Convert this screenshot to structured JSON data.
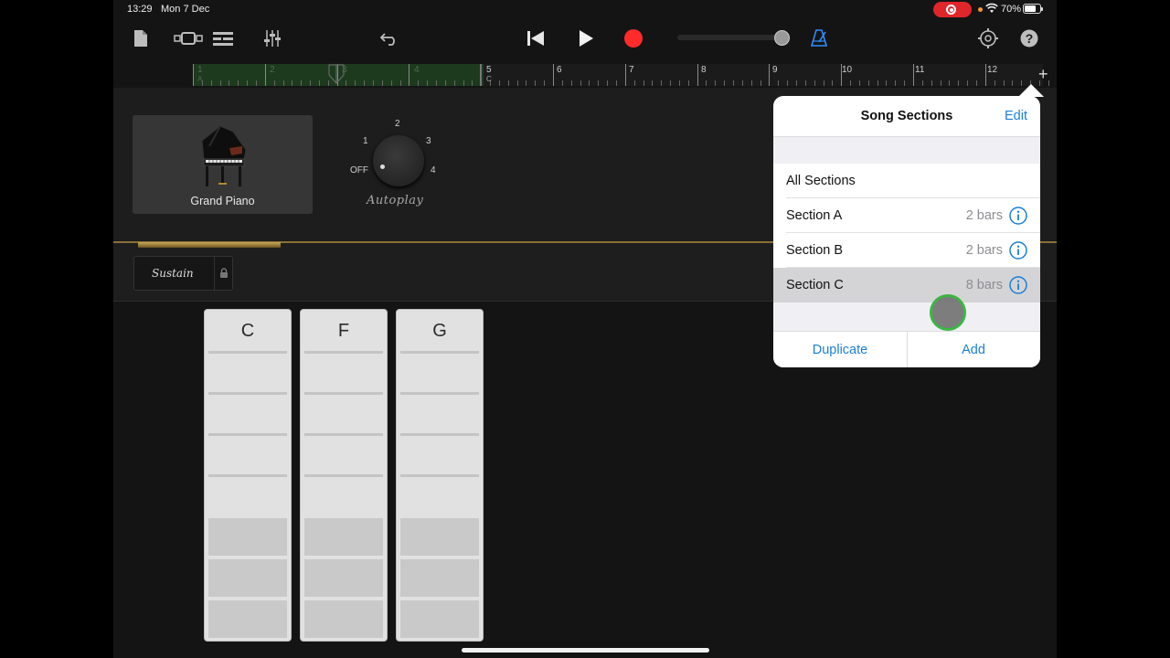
{
  "status_bar": {
    "time": "13:29",
    "date": "Mon 7 Dec",
    "battery": "70%"
  },
  "toolbar": {
    "icons": [
      "my-songs-icon",
      "browser-icon",
      "tracks-view-icon",
      "mixer-icon",
      "undo-icon",
      "go-to-beginning-icon",
      "play-icon",
      "record-icon",
      "metronome-icon",
      "settings-icon",
      "help-icon"
    ],
    "record_color": "#ff2b2b",
    "accent_color": "#2f8dff"
  },
  "ruler": {
    "bars": [
      "1",
      "2",
      "3",
      "4",
      "5",
      "6",
      "7",
      "8",
      "9",
      "10",
      "11",
      "12"
    ],
    "section_markers": [
      "A",
      "C"
    ],
    "add_label": "+"
  },
  "instrument": {
    "name": "Grand Piano"
  },
  "autoplay": {
    "label": "Autoplay",
    "positions": [
      "OFF",
      "1",
      "2",
      "3",
      "4"
    ]
  },
  "sustain": {
    "label": "Sustain"
  },
  "chords": [
    {
      "name": "C"
    },
    {
      "name": "F"
    },
    {
      "name": "G"
    }
  ],
  "popover": {
    "title": "Song Sections",
    "edit": "Edit",
    "all_sections": "All Sections",
    "sections": [
      {
        "label": "Section A",
        "bars": "2 bars"
      },
      {
        "label": "Section B",
        "bars": "2 bars"
      },
      {
        "label": "Section C",
        "bars": "8 bars",
        "selected": true
      }
    ],
    "duplicate": "Duplicate",
    "add": "Add"
  }
}
